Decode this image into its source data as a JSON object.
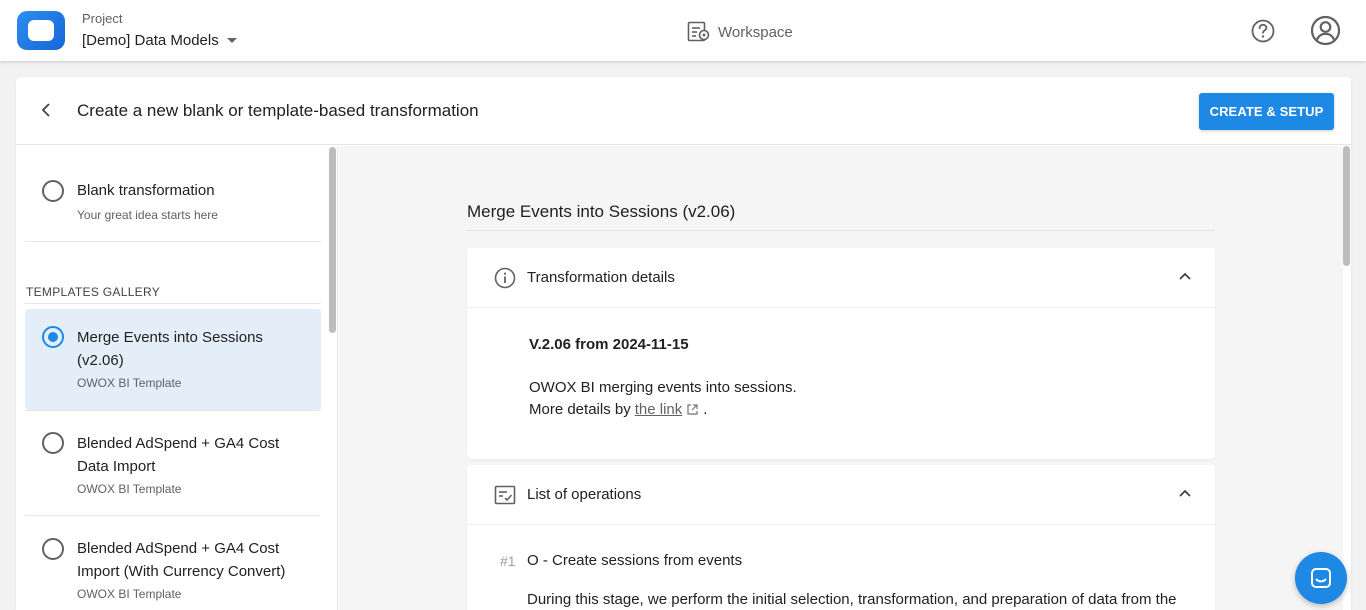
{
  "topbar": {
    "project_label": "Project",
    "project_name": "[Demo] Data Models",
    "workspace_label": "Workspace"
  },
  "header": {
    "title": "Create a new blank or template-based transformation",
    "create_button": "CREATE & SETUP"
  },
  "left": {
    "blank": {
      "title": "Blank transformation",
      "subtitle": "Your great idea starts here"
    },
    "gallery_label": "TEMPLATES GALLERY",
    "templates": [
      {
        "title_line1": "Merge Events into Sessions",
        "title_line2": "(v2.06)",
        "subtitle": "OWOX BI Template",
        "selected": true
      },
      {
        "title_line1": "Blended AdSpend + GA4 Cost",
        "title_line2": "Data Import",
        "subtitle": "OWOX BI Template",
        "selected": false
      },
      {
        "title_line1": "Blended AdSpend + GA4 Cost",
        "title_line2": "Import (With Currency Convert)",
        "subtitle": "OWOX BI Template",
        "selected": false
      }
    ]
  },
  "detail": {
    "title": "Merge Events into Sessions (v2.06)",
    "details_section": {
      "title": "Transformation details",
      "version": "V.2.06 from 2024-11-15",
      "description": "OWOX BI merging events into sessions.",
      "more_prefix": "More details by",
      "link_text": "the link",
      "more_suffix": "."
    },
    "operations_section": {
      "title": "List of operations",
      "op_number": "#1",
      "op_title": "O - Create sessions from events",
      "op_text": "During this stage, we perform the initial selection, transformation, and preparation of data from the"
    }
  },
  "colors": {
    "accent": "#1e88e5",
    "selected_bg": "#e3eef9"
  }
}
